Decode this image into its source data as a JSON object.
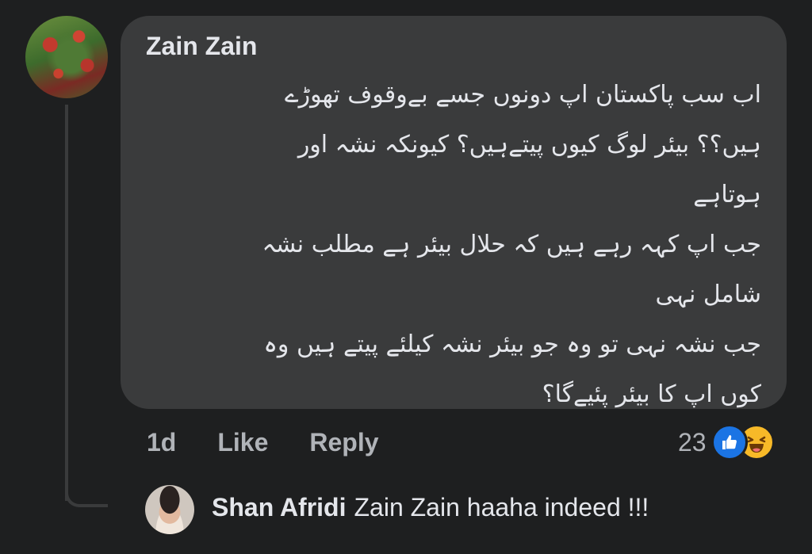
{
  "comment": {
    "author": "Zain Zain",
    "lines": [
      "اب سب پاکستان اپ دونوں جسے بےوقوف تھوڑے",
      "ہیں؟؟ بیئر لوگ کیوں پیتےہیں؟ کیونکہ نشہ اور",
      "ہوتاہے",
      "جب اپ کہہ رہے ہیں کہ حلال بیئر ہے مطلب نشہ",
      "شامل نہی",
      "جب نشہ نہی تو وہ جو بیئر نشہ کیلئے پیتے ہیں وہ",
      "کوں اپ کا بیئر پئیےگا؟"
    ],
    "time": "1d",
    "like_label": "Like",
    "reply_label": "Reply",
    "reaction_count": "23",
    "reaction_icons": [
      "like-reaction-icon",
      "haha-reaction-icon"
    ]
  },
  "reply": {
    "author": "Shan Afridi",
    "text": "Zain Zain haaha indeed !!!"
  },
  "colors": {
    "background": "#1e1f20",
    "bubble": "#3a3b3c",
    "like_blue": "#1b74e4",
    "haha_yellow": "#f7b928"
  }
}
